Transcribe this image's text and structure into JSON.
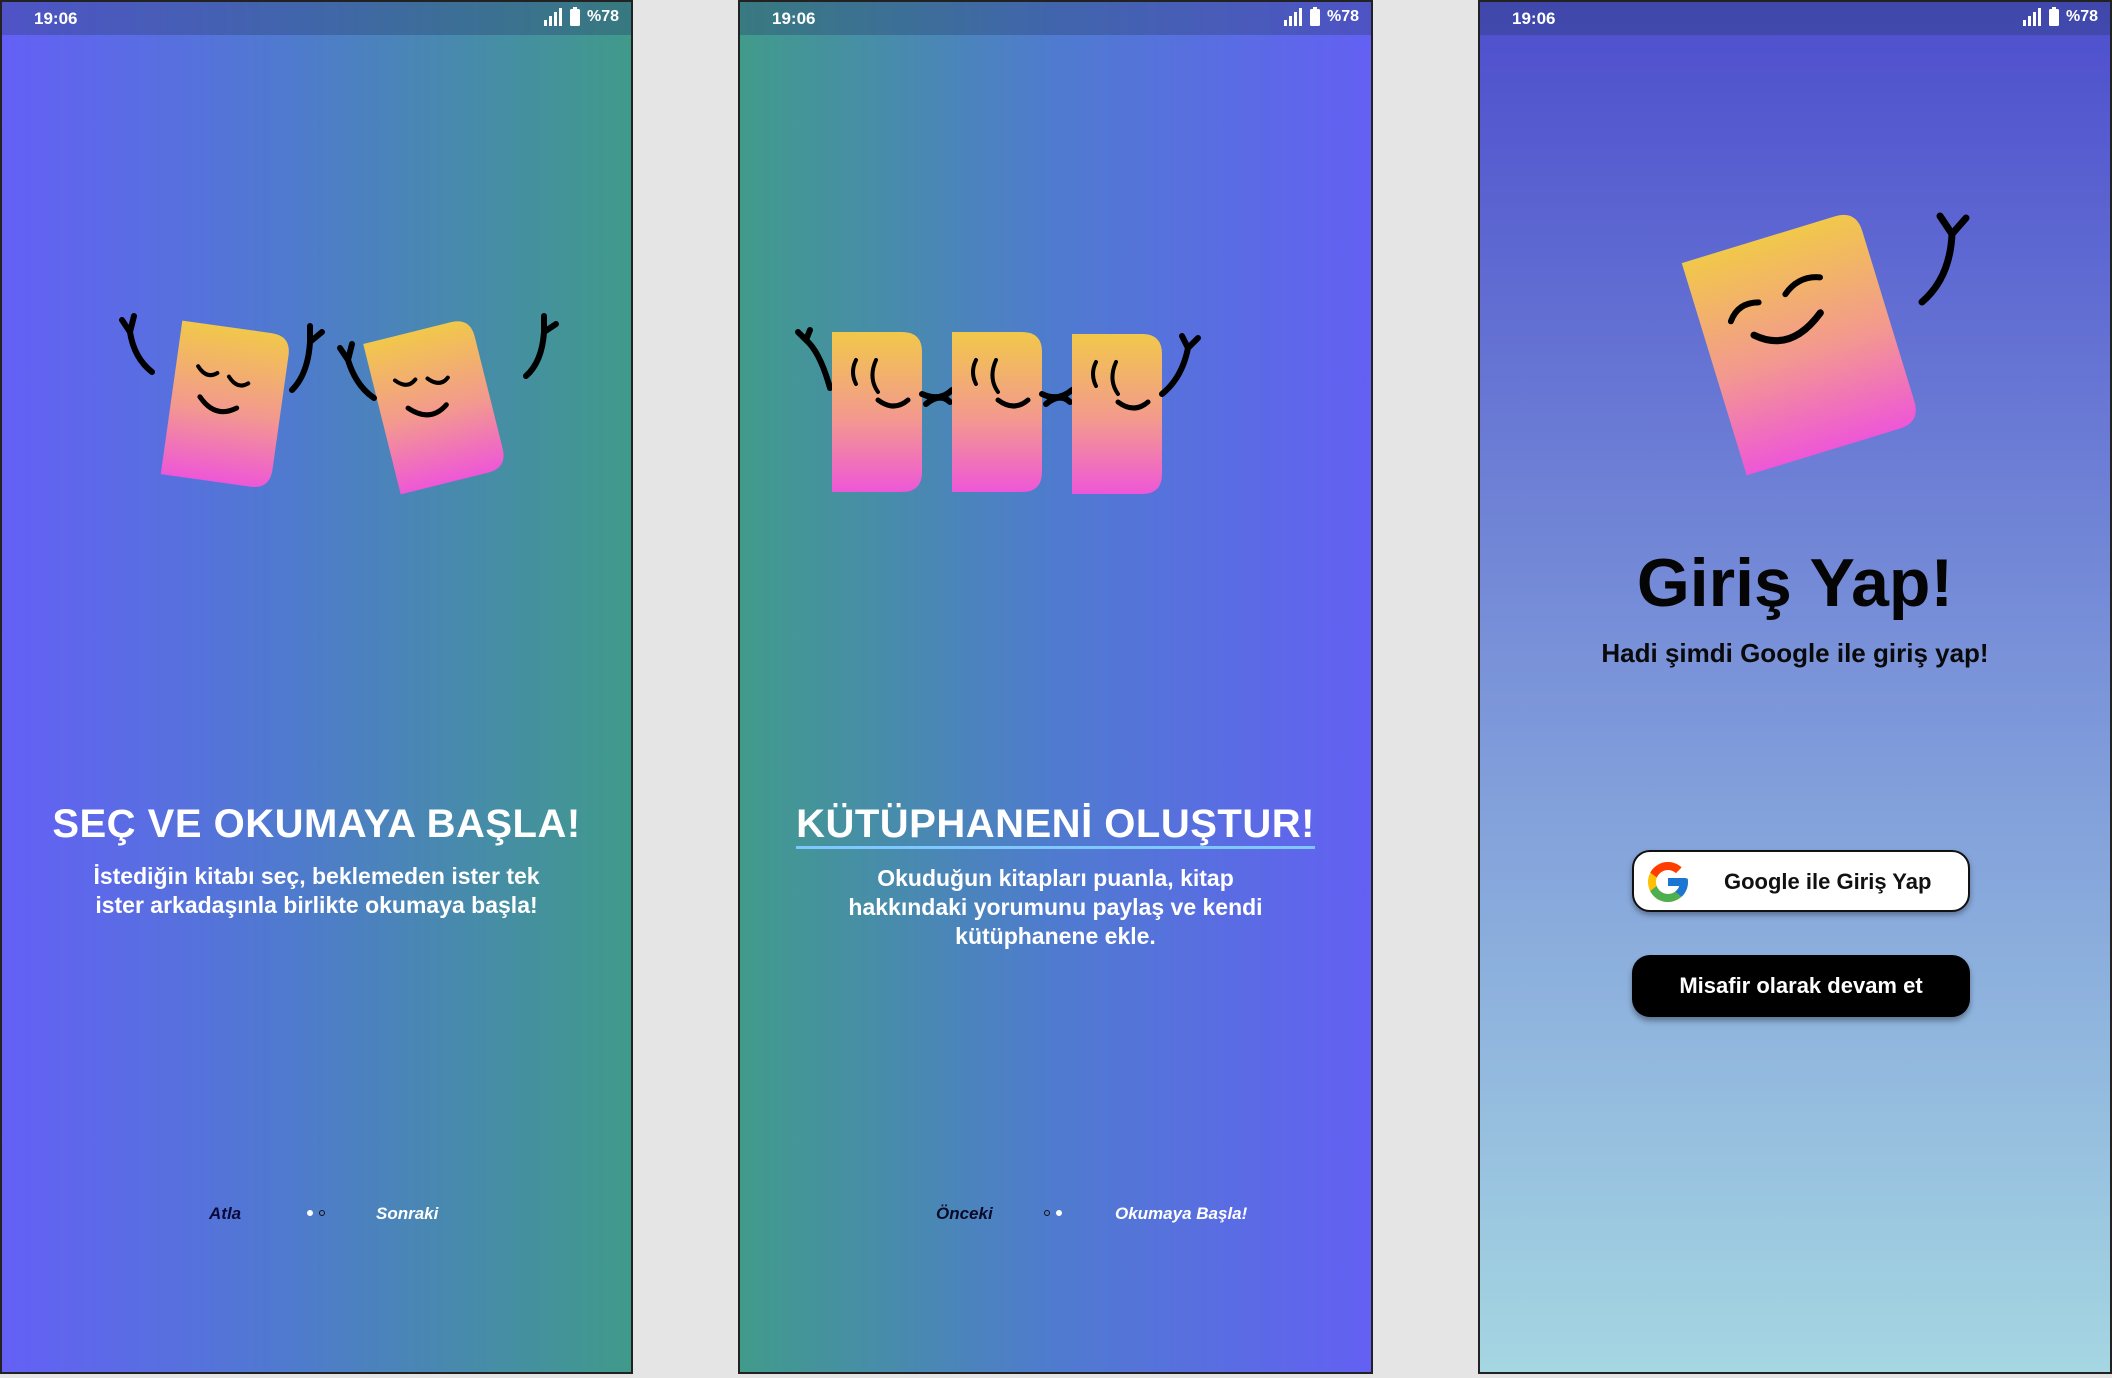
{
  "status_bar": {
    "time": "19:06",
    "battery": "%78"
  },
  "screen1": {
    "title": "SEÇ VE OKUMAYA BAŞLA!",
    "description": "İstediğin kitabı seç, beklemeden ister tek ister arkadaşınla birlikte okumaya başla!",
    "nav": {
      "skip_label": "Atla",
      "next_label": "Sonraki"
    },
    "pager": {
      "current": 1,
      "total": 2
    }
  },
  "screen2": {
    "title": "KÜTÜPHANENİ OLUŞTUR!",
    "description": "Okuduğun kitapları puanla, kitap hakkındaki yorumunu paylaş ve kendi kütüphanene ekle.",
    "nav": {
      "prev_label": "Önceki",
      "start_label": "Okumaya Başla!"
    },
    "pager": {
      "current": 2,
      "total": 2
    }
  },
  "screen3": {
    "title": "Giriş Yap!",
    "subtitle": "Hadi şimdi Google ile giriş yap!",
    "google_button_label": "Google ile Giriş Yap",
    "guest_button_label": "Misafir olarak devam et"
  },
  "icons": [
    "signal-icon",
    "battery-icon",
    "google-icon",
    "book-character-icon"
  ],
  "colors": {
    "book_gradient_top": "#f0c84a",
    "book_gradient_bottom": "#ef5bd6",
    "purple": "#6460f6",
    "teal": "#409a8a"
  }
}
